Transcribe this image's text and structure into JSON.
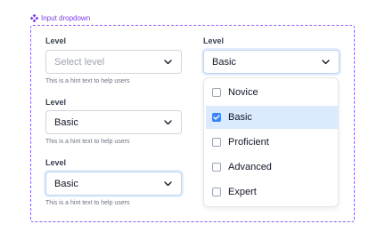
{
  "frame": {
    "label": "Input dropdown"
  },
  "fields": [
    {
      "label": "Level",
      "value": "",
      "placeholder": "Select level",
      "hint": "This is a hint text to help users"
    },
    {
      "label": "Level",
      "value": "Basic",
      "hint": "This is a hint text to help users"
    },
    {
      "label": "Level",
      "value": "Basic",
      "hint": "This is a hint text to help users"
    },
    {
      "label": "Level",
      "value": "Basic"
    }
  ],
  "menu": {
    "options": [
      {
        "label": "Novice",
        "checked": false
      },
      {
        "label": "Basic",
        "checked": true
      },
      {
        "label": "Proficient",
        "checked": false
      },
      {
        "label": "Advanced",
        "checked": false
      },
      {
        "label": "Expert",
        "checked": false
      }
    ]
  },
  "colors": {
    "accent": "#3b82f6",
    "frame": "#8b5cf6",
    "selected_bg": "#dbeafe",
    "focus_ring": "#e4eefb"
  },
  "icons": {
    "frame": "component-icon",
    "select": "chevron-down-icon",
    "check": "check-icon"
  }
}
